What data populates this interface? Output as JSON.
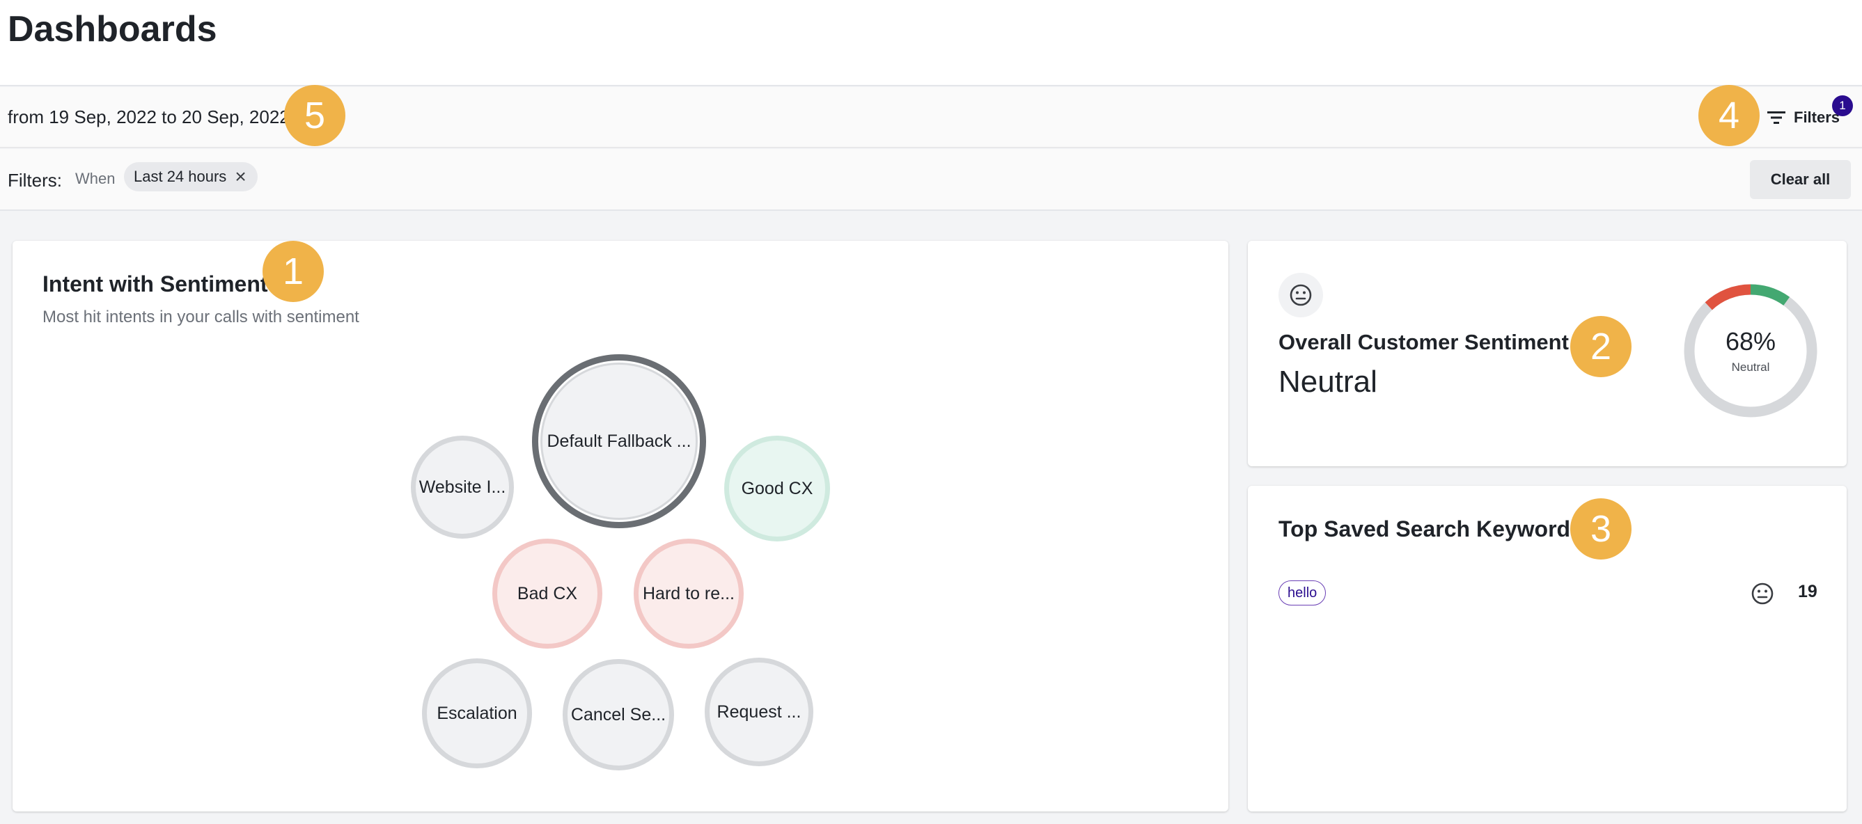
{
  "page": {
    "title": "Dashboards"
  },
  "date_bar": {
    "range_text": "from 19 Sep, 2022 to 20 Sep, 2022",
    "filters_label": "Filters",
    "filters_count": "1"
  },
  "filter_bar": {
    "label": "Filters:",
    "when_label": "When",
    "chip_label": "Last 24 hours",
    "clear_all_label": "Clear all"
  },
  "intent_card": {
    "title": "Intent with Sentiment",
    "subtitle": "Most hit intents in your calls with sentiment",
    "bubbles": [
      {
        "label": "Default Fallback ...",
        "sentiment": "neutral-top"
      },
      {
        "label": "Website I...",
        "sentiment": "neutral"
      },
      {
        "label": "Good CX",
        "sentiment": "positive"
      },
      {
        "label": "Bad CX",
        "sentiment": "negative"
      },
      {
        "label": "Hard to re...",
        "sentiment": "negative"
      },
      {
        "label": "Escalation",
        "sentiment": "neutral"
      },
      {
        "label": "Cancel Se...",
        "sentiment": "neutral"
      },
      {
        "label": "Request ...",
        "sentiment": "neutral"
      }
    ]
  },
  "sentiment_card": {
    "icon": "neutral-face-icon",
    "title": "Overall Customer Sentiment",
    "value": "Neutral",
    "gauge": {
      "percent_text": "68%",
      "label": "Neutral",
      "negative_share": 0.12,
      "positive_share": 0.1
    }
  },
  "keywords_card": {
    "title": "Top Saved Search Keywords",
    "keywords": [
      {
        "keyword": "hello",
        "icon": "neutral-face-icon",
        "count": "19"
      }
    ]
  },
  "callouts": [
    "1",
    "2",
    "3",
    "4",
    "5"
  ],
  "colors": {
    "callout": "#f0b349",
    "accent": "#2a0c8f",
    "positive": "#43a871",
    "negative": "#e0533f",
    "neutral": "#d6d8db"
  }
}
